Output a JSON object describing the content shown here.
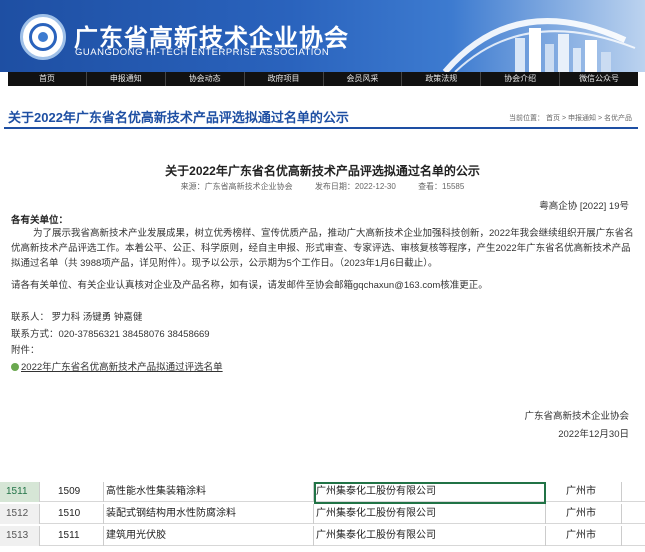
{
  "header": {
    "org_cn": "广东省高新技术企业协会",
    "org_en": "GUANGDONG HI-TECH ENTERPRISE ASSOCIATION"
  },
  "nav": [
    "首页",
    "申报通知",
    "协会动态",
    "政府项目",
    "会员风采",
    "政策法规",
    "协会介绍",
    "微信公众号"
  ],
  "page_title": "关于2022年广东省名优高新技术产品评选拟通过名单的公示",
  "breadcrumb": [
    "当前位置：",
    "首页",
    ">",
    "申报通知",
    ">",
    "名优产品"
  ],
  "article": {
    "title": "关于2022年广东省名优高新技术产品评选拟通过名单的公示",
    "source": "来源：广东省高新技术企业协会",
    "date": "发布日期：2022-12-30",
    "views": "查看：15585",
    "doc_no": "粤高企协 [2022] 19号",
    "greeting": "各有关单位：",
    "body": "为了展示我省高新技术产业发展成果，树立优秀榜样、宣传优质产品，推动广大高新技术企业加强科技创新，2022年我会继续组织开展广东省名优高新技术产品评选工作。本着公平、公正、科学原则，经自主申报、形式审查、专家评选、审核复核等程序，产生2022年广东省名优高新技术产品拟通过名单（共 3988项产品，详见附件）。现予以公示，公示期为5个工作日。（2023年1月6日截止）。",
    "body2": "请各有关单位、有关企业认真核对企业及产品名称，如有误，请发邮件至协会邮箱gqchaxun@163.com核准更正。",
    "contacts": "联系人：  罗力科  汤键勇  钟嘉健",
    "phone": "联系方式：020-37856321  38458076  38458669",
    "attach_label": "附件：",
    "attach_link": "2022年广东省名优高新技术产品拟通过评选名单",
    "signature": "广东省高新技术企业协会",
    "sign_date": "2022年12月30日"
  },
  "sheet": {
    "rows": [
      {
        "rn": "1511",
        "no": "1509",
        "product": "高性能水性集装箱涂料",
        "company": "广州集泰化工股份有限公司",
        "city": "广州市"
      },
      {
        "rn": "1512",
        "no": "1510",
        "product": "装配式钢结构用水性防腐涂料",
        "company": "广州集泰化工股份有限公司",
        "city": "广州市"
      },
      {
        "rn": "1513",
        "no": "1511",
        "product": "建筑用光伏胶",
        "company": "广州集泰化工股份有限公司",
        "city": "广州市"
      }
    ]
  },
  "colors": {
    "brand": "#1e4fa3",
    "nav_bg": "#111111",
    "excel_green": "#217346"
  }
}
